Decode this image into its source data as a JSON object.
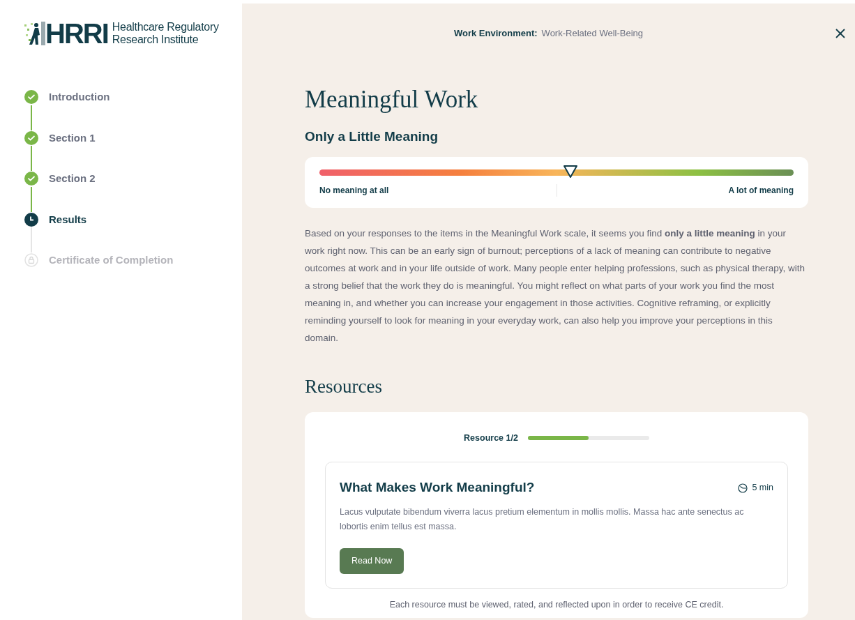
{
  "logo": {
    "mark": "HRRI",
    "name_line_1": "Healthcare Regulatory",
    "name_line_2": "Research Institute"
  },
  "steps": [
    {
      "label": "Introduction",
      "kind": "done"
    },
    {
      "label": "Section 1",
      "kind": "done"
    },
    {
      "label": "Section 2",
      "kind": "done"
    },
    {
      "label": "Results",
      "kind": "current"
    },
    {
      "label": "Certificate of Completion",
      "kind": "locked"
    }
  ],
  "header": {
    "category": "Work Environment:",
    "topic": "Work-Related Well-Being"
  },
  "title": "Meaningful Work",
  "result_label": "Only a Little Meaning",
  "scale": {
    "level": 0.53,
    "min_label": "No meaning at all",
    "max_label": "A lot of meaning"
  },
  "description": "Based on your responses to the items in the Meaningful Work scale, it seems you find **only a little meaning** in your work right now. This can be an early sign of burnout; perceptions of a lack of meaning can contribute to negative outcomes at work and in your life outside of work. Many people enter helping professions, such as physical therapy, with a strong belief that the work they do is meaningful. You might reflect on what parts of your work you find the most meaning in, and whether you can increase your engagement in those activities. Cognitive reframing, or explicitly reminding yourself to look for meaning in your everyday work, can also help you improve your perceptions in this domain.",
  "resources": {
    "heading": "Resources",
    "counter": "Resource 1/2",
    "level": 0.5,
    "card": {
      "title": "What Makes Work Meaningful?",
      "duration": "5 min",
      "text": "Lacus vulputate bibendum viverra lacus pretium elementum in mollis mollis. Massa hac ante senectus ac lobortis enim tellus est massa.",
      "button": "Read Now"
    },
    "note": "Each resource must be viewed, rated, and reflected upon in order to receive CE credit."
  }
}
